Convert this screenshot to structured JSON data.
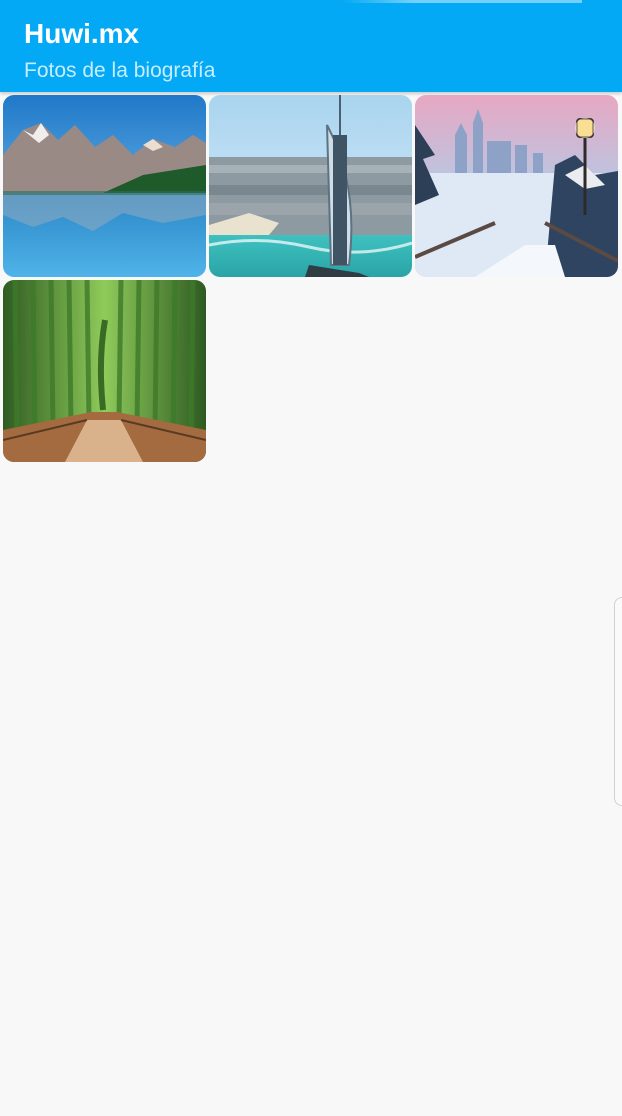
{
  "appbar": {
    "title": "Huwi.mx",
    "subtitle": "Fotos de la biografía",
    "color": "#03a9f4"
  },
  "photos": [
    {
      "name": "mountain-lake-photo",
      "scene": "mountain lake reflection"
    },
    {
      "name": "burj-al-arab-photo",
      "scene": "sail-shaped hotel by the sea"
    },
    {
      "name": "snowy-castle-photo",
      "scene": "snowy castle with lamp and stairs"
    },
    {
      "name": "bamboo-forest-photo",
      "scene": "bamboo forest path"
    }
  ]
}
